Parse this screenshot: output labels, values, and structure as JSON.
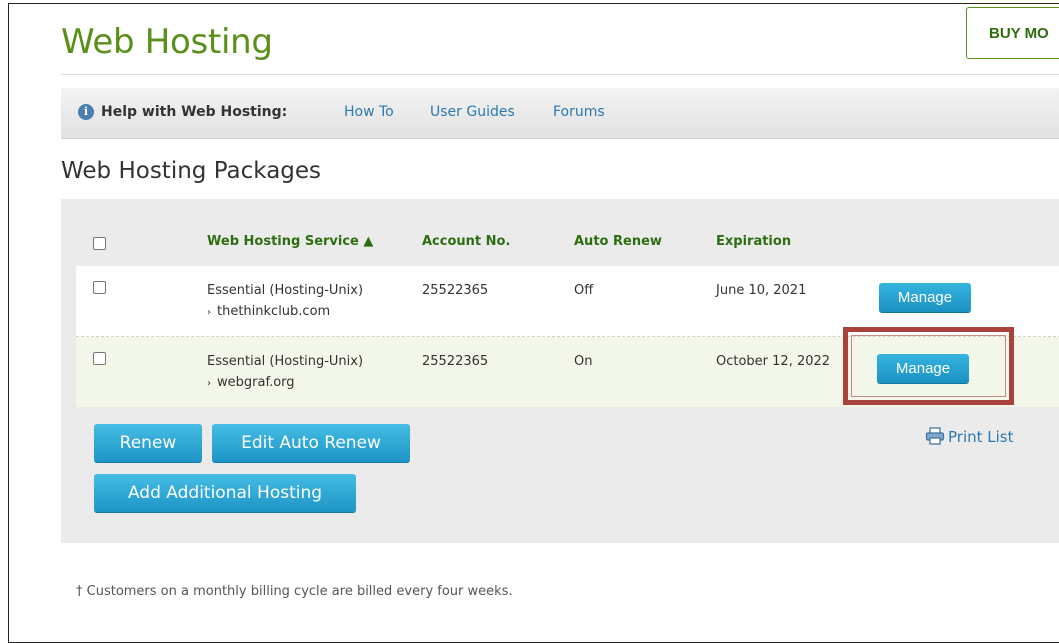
{
  "header": {
    "title": "Web Hosting",
    "buy_button_label": "BUY MO"
  },
  "help_bar": {
    "icon": "info-icon",
    "label": "Help with Web Hosting:",
    "links": [
      "How To",
      "User Guides",
      "Forums"
    ]
  },
  "section_title": "Web Hosting Packages",
  "table": {
    "columns": {
      "service": "Web Hosting Service ▲",
      "account": "Account No.",
      "auto_renew": "Auto Renew",
      "expiration": "Expiration"
    },
    "rows": [
      {
        "service": "Essential (Hosting-Unix)",
        "domain": "thethinkclub.com",
        "account": "25522365",
        "auto_renew": "Off",
        "expiration": "June 10, 2021",
        "manage_label": "Manage",
        "checked": false
      },
      {
        "service": "Essential (Hosting-Unix)",
        "domain": "webgraf.org",
        "account": "25522365",
        "auto_renew": "On",
        "expiration": "October 12, 2022",
        "manage_label": "Manage",
        "checked": false
      }
    ]
  },
  "actions": {
    "renew": "Renew",
    "edit_auto_renew": "Edit Auto Renew",
    "add_hosting": "Add Additional Hosting",
    "print_list": "Print List"
  },
  "footnote": "† Customers on a monthly billing cycle are billed every four weeks.",
  "colors": {
    "brand_green": "#5a8f1a",
    "link_blue": "#2a7ab0",
    "button_blue": "#1d94c4",
    "highlight_red": "#a8423a",
    "off_red": "#d0201a"
  }
}
